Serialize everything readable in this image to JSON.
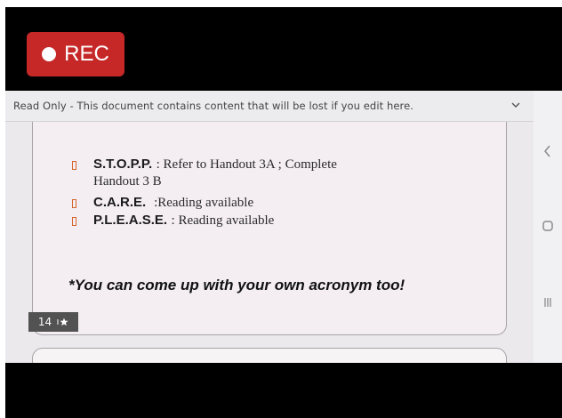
{
  "recording": {
    "label": "REC"
  },
  "banner": {
    "text": "Read Only - This document contains content that will be lost if you edit here."
  },
  "slide": {
    "bullets": [
      {
        "acronym": "S.T.O.P.P.",
        "description": ": Refer to Handout 3A ; Complete",
        "continuation": "Handout 3 B"
      },
      {
        "acronym": "C.A.R.E.",
        "description": ":Reading available"
      },
      {
        "acronym": "P.L.E.A.S.E.",
        "description": ": Reading available"
      }
    ],
    "note": "*You can come up with your own acronym too!",
    "page_badge": "14"
  },
  "nav_icons": [
    "back-icon",
    "home-icon",
    "recents-icon"
  ],
  "colors": {
    "rec_button": "#c62828",
    "bullet": "#d4652b",
    "slide_bg": "#f4eef2"
  }
}
